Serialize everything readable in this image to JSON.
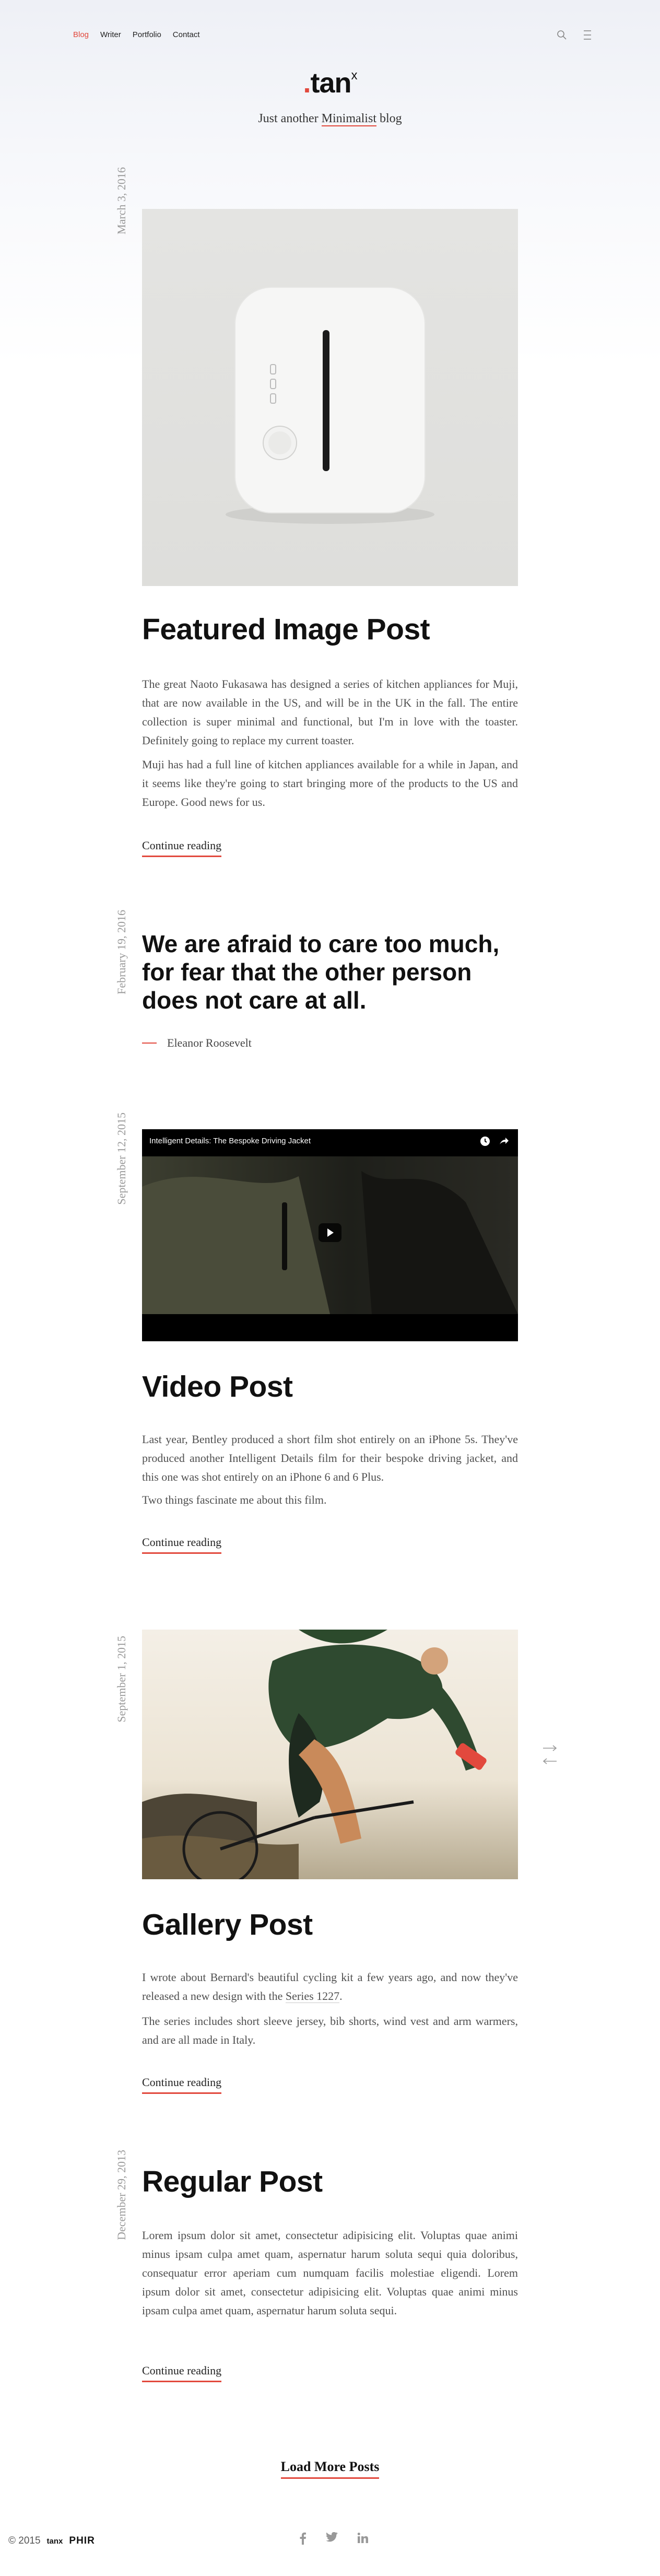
{
  "nav": {
    "items": [
      "Blog",
      "Writer",
      "Portfolio",
      "Contact"
    ]
  },
  "header": {
    "logo_dot": ".",
    "logo": "tan",
    "logo_sup": "x",
    "tagline_pre": "Just another ",
    "tagline_em": "Minimalist",
    "tagline_post": " blog"
  },
  "posts": [
    {
      "date": "March 3, 2016",
      "title": "Featured Image Post",
      "paragraphs": [
        "The great Naoto Fukasawa has designed a series of kitchen appliances for Muji, that are now available in the US, and will be in the UK in the fall. The entire collection is super minimal and functional, but I'm in love with the toaster. Definitely going to replace my current toaster.",
        "Muji has had a full line of kitchen appliances available for a while in Japan, and it seems like they're going to start bringing more of the products to the US and Europe. Good news for us."
      ],
      "continue": "Continue reading"
    },
    {
      "date": "February 19, 2016",
      "quote": "We are afraid to care too much, for fear that the other person does not care at all.",
      "author": "Eleanor Roosevelt"
    },
    {
      "date": "September 12, 2015",
      "video_title": "Intelligent Details: The Bespoke Driving Jacket",
      "title": "Video Post",
      "paragraphs": [
        "Last year, Bentley produced a short film shot entirely on an iPhone 5s. They've produced another Intelligent Details film for their bespoke driving jacket, and this one was shot entirely on an iPhone 6 and 6 Plus.",
        "Two things fascinate me about this film."
      ],
      "continue": "Continue reading"
    },
    {
      "date": "September 1, 2015",
      "title": "Gallery Post",
      "p1_pre": "I wrote about Bernard's beautiful cycling kit a few years ago, and now they've released a new design with the ",
      "p1_link": "Series 1227",
      "p1_post": ".",
      "p2": "The series includes short sleeve jersey, bib shorts, wind vest and arm warmers, and are all made in Italy.",
      "continue": "Continue reading"
    },
    {
      "date": "December 29, 2013",
      "title": "Regular Post",
      "paragraphs": [
        "Lorem ipsum dolor sit amet, consectetur adipisicing elit. Voluptas quae animi minus ipsam culpa amet quam, aspernatur harum soluta sequi quia doloribus, consequatur error aperiam cum numquam facilis molestiae eligendi. Lorem ipsum dolor sit amet, consectetur adipisicing elit. Voluptas quae animi minus ipsam culpa amet quam, aspernatur harum soluta sequi."
      ],
      "continue": "Continue reading"
    }
  ],
  "load_more": "Load More Posts",
  "footer": {
    "copyright": "© 2015",
    "brand_small": "tanx",
    "brand": "PHIR"
  },
  "colors": {
    "accent": "#e2493d",
    "text": "#4f4f4f",
    "heading": "#111111"
  },
  "icons": [
    "search-icon",
    "menu-icon",
    "play-icon",
    "clock-icon",
    "share-icon",
    "arrow-right-icon",
    "arrow-left-icon",
    "facebook-icon",
    "twitter-icon",
    "linkedin-icon"
  ]
}
